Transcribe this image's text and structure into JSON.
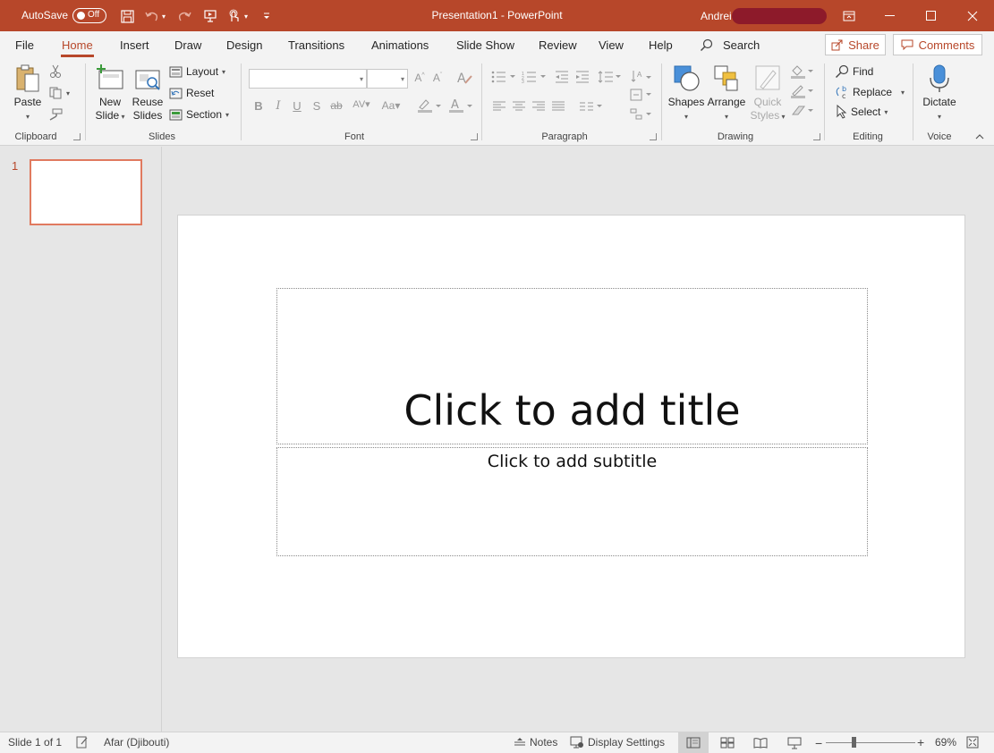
{
  "titlebar": {
    "autosave_label": "AutoSave",
    "autosave_state": "Off",
    "doc_title": "Presentation1  -  PowerPoint",
    "user_name": "Andrei"
  },
  "tabs": [
    {
      "label": "File"
    },
    {
      "label": "Home"
    },
    {
      "label": "Insert"
    },
    {
      "label": "Draw"
    },
    {
      "label": "Design"
    },
    {
      "label": "Transitions"
    },
    {
      "label": "Animations"
    },
    {
      "label": "Slide Show"
    },
    {
      "label": "Review"
    },
    {
      "label": "View"
    },
    {
      "label": "Help"
    }
  ],
  "search": {
    "label": "Search"
  },
  "share": {
    "label": "Share"
  },
  "comments": {
    "label": "Comments"
  },
  "ribbon": {
    "clipboard": {
      "label": "Clipboard",
      "paste": "Paste"
    },
    "slides": {
      "label": "Slides",
      "new_slide_1": "New",
      "new_slide_2": "Slide",
      "reuse_1": "Reuse",
      "reuse_2": "Slides",
      "layout": "Layout",
      "reset": "Reset",
      "section": "Section"
    },
    "font": {
      "label": "Font"
    },
    "paragraph": {
      "label": "Paragraph"
    },
    "drawing": {
      "label": "Drawing",
      "shapes": "Shapes",
      "arrange": "Arrange",
      "quick_1": "Quick",
      "quick_2": "Styles"
    },
    "editing": {
      "label": "Editing",
      "find": "Find",
      "replace": "Replace",
      "select": "Select"
    },
    "voice": {
      "label": "Voice",
      "dictate": "Dictate"
    }
  },
  "thumbnails": [
    {
      "number": "1"
    }
  ],
  "slide": {
    "title_placeholder": "Click to add title",
    "subtitle_placeholder": "Click to add subtitle"
  },
  "statusbar": {
    "slide_count": "Slide 1 of 1",
    "language": "Afar (Djibouti)",
    "notes": "Notes",
    "display_settings": "Display Settings",
    "zoom": "69%",
    "zoom_fraction": 0.31
  },
  "colors": {
    "accent": "#b7472a",
    "thumb_border": "#e07a5f"
  }
}
